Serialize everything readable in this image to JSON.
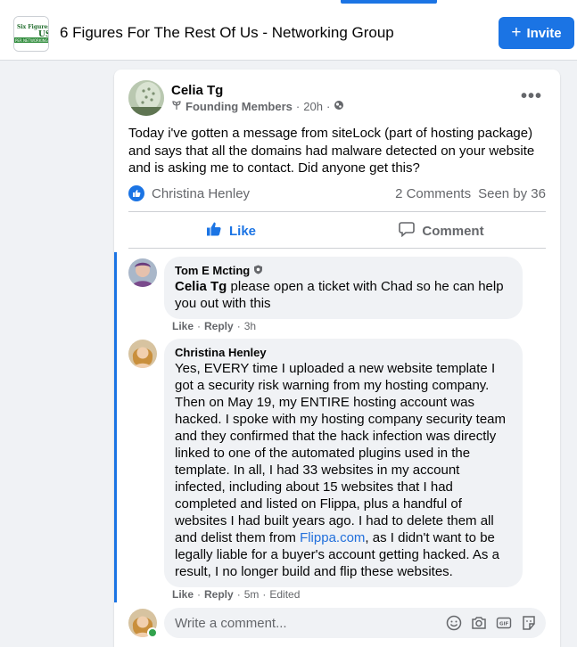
{
  "header": {
    "group_title": "6 Figures For The Rest Of Us - Networking Group",
    "invite_label": "Invite",
    "logo_text_top": "Six Figures",
    "logo_text_bottom": "US",
    "logo_banner": "PER NETWORKING GR"
  },
  "post": {
    "author": "Celia Tg",
    "badge": "Founding Members",
    "time": "20h",
    "privacy_icon": "globe-icon",
    "text": "Today i've gotten a message from siteLock (part of hosting package) and says that all the domains had malware detected on your website and is asking me to contact.  Did anyone get this?",
    "reactor": "Christina Henley",
    "comments_count": "2 Comments",
    "seen_by": "Seen by 36",
    "like_label": "Like",
    "comment_label": "Comment"
  },
  "comments": [
    {
      "author": "Tom E Mcting",
      "mention": "Celia Tg",
      "text": " please open a ticket with Chad so he can help you out with this",
      "like": "Like",
      "reply": "Reply",
      "time": "3h"
    },
    {
      "author": "Christina Henley",
      "text_before_link": "Yes, EVERY time I uploaded a new website template I got a security risk warning from my hosting company. Then on May 19, my ENTIRE hosting account was hacked. I spoke with my hosting company security team and they confirmed that the hack infection was directly linked to one of the automated plugins used in the template. In all, I had 33 websites in my account infected, including about 15 websites that I had completed and listed on Flippa, plus a handful of websites I had built years ago. I had to delete them all and delist them from ",
      "link": "Flippa.com",
      "text_after_link": ", as I didn't want to be legally liable for a buyer's account getting hacked. As a result, I no longer build and flip these websites.",
      "like": "Like",
      "reply": "Reply",
      "time": "5m",
      "edited": "Edited"
    }
  ],
  "composer": {
    "placeholder": "Write a comment...",
    "icons": [
      "emoji-icon",
      "camera-icon",
      "gif-icon",
      "sticker-icon"
    ]
  },
  "colors": {
    "accent": "#1b74e4",
    "text_secondary": "#65676b",
    "background": "#f0f2f5",
    "online": "#31a24c"
  }
}
